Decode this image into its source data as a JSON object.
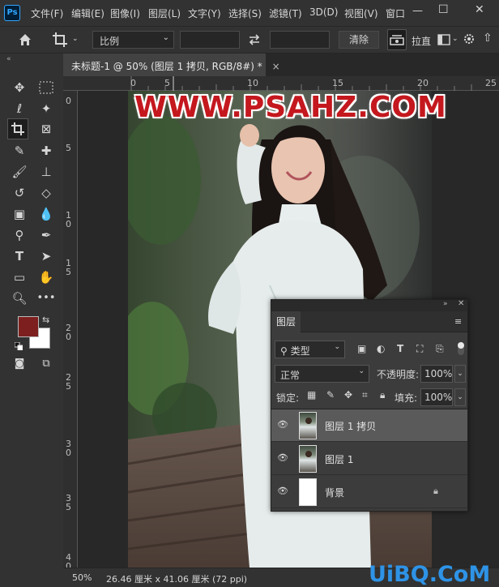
{
  "menubar": {
    "app_icon": "Ps",
    "items": [
      "文件(F)",
      "编辑(E)",
      "图像(I)",
      "图层(L)",
      "文字(Y)",
      "选择(S)",
      "滤镜(T)",
      "3D(D)",
      "视图(V)",
      "窗口"
    ],
    "window_controls": [
      "—",
      "☐",
      "✕"
    ]
  },
  "options": {
    "home_icon": "home-icon",
    "crop_icon": "crop-icon",
    "ratio_value": "比例",
    "swap_icon": "swap-icon",
    "clear_label": "清除",
    "straighten_label": "拉直"
  },
  "document": {
    "tab_title": "未标题-1 @ 50% (图层 1 拷贝, RGB/8#) *",
    "tab_close": "×"
  },
  "ruler": {
    "top_ticks": [
      "0",
      "5",
      "10",
      "15",
      "20",
      "25"
    ],
    "left_ticks": [
      "0",
      "5",
      "1\n0",
      "1\n5",
      "2\n0",
      "2\n5",
      "3\n0",
      "3\n5",
      "4\n0"
    ]
  },
  "canvas": {
    "watermark": "WWW.PSAHZ.COM"
  },
  "status": {
    "zoom": "50%",
    "doc_size": "26.46 厘米 x 41.06 厘米 (72 ppi)"
  },
  "site_watermark": "UiBQ.CoM",
  "colors": {
    "foreground": "#7d1f1f",
    "background": "#ffffff",
    "watermark": "#c4181e",
    "site_watermark": "#2e93e6"
  },
  "layers_panel": {
    "tab_label": "图层",
    "kind_value": "类型",
    "blend_mode": "正常",
    "opacity_label": "不透明度:",
    "opacity_value": "100%",
    "lock_label": "锁定:",
    "fill_label": "填充:",
    "fill_value": "100%",
    "layers": [
      {
        "name": "图层 1 拷贝",
        "selected": true
      },
      {
        "name": "图层 1",
        "selected": false
      },
      {
        "name": "背景",
        "selected": false,
        "locked": true
      }
    ]
  }
}
